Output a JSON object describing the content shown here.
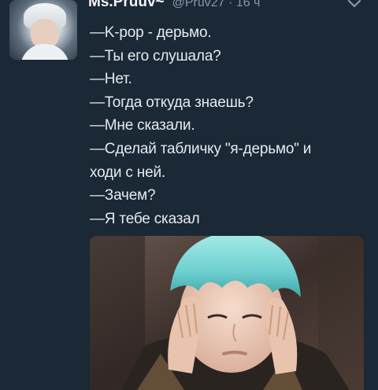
{
  "tweet": {
    "username": "Ms.Pruuv~",
    "handle": "@Pruv27",
    "separator": "·",
    "time": "16 ч",
    "lines": [
      "—K-pop - дерьмо.",
      "—Ты его слушала?",
      "—Нет.",
      "—Тогда откуда знаешь?",
      "—Мне сказали.",
      "—Сделай табличку \"я-дерьмо\" и",
      "ходи с ней.",
      "—Зачем?",
      "—Я тебе сказал"
    ]
  },
  "icons": {
    "menu": "chevron-down-icon"
  },
  "colors": {
    "background": "#1b2836",
    "text": "#e6ebef",
    "muted": "#8899a6",
    "hair_accent": "#7fd3d4"
  }
}
